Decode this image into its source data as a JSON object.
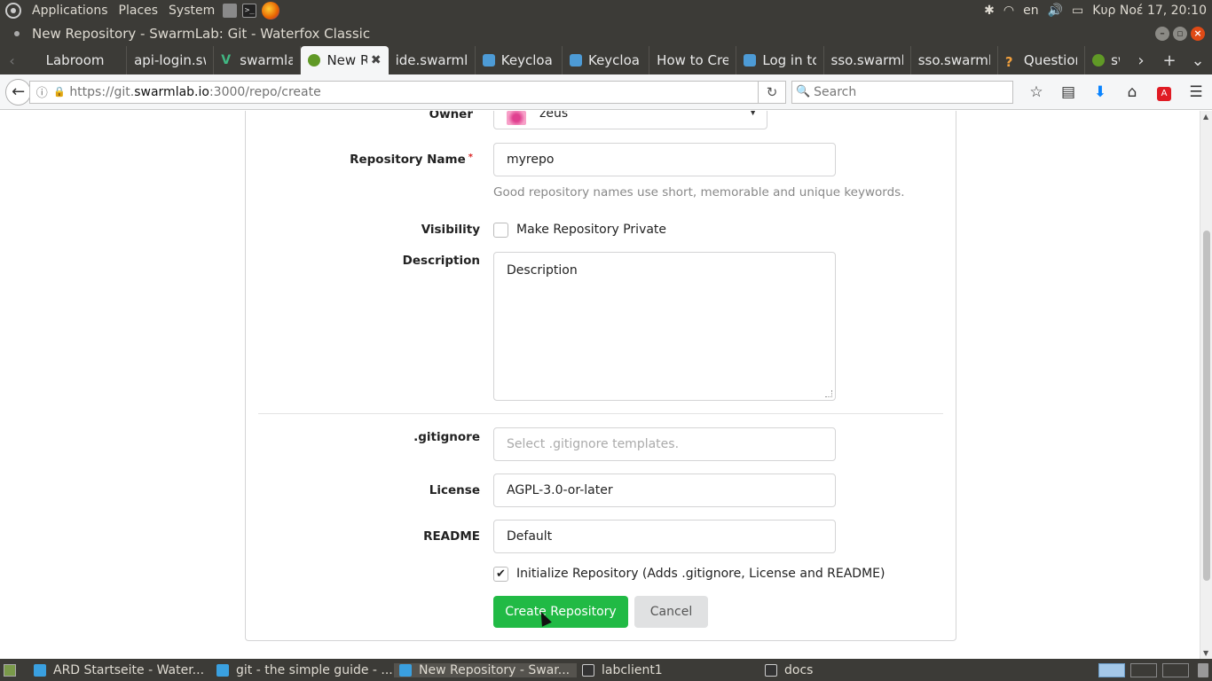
{
  "os_panel": {
    "menus": [
      "Applications",
      "Places",
      "System"
    ],
    "tray": {
      "language": "en",
      "clock": "Κυρ Νοέ 17, 20:10"
    }
  },
  "window": {
    "title": "New Repository - SwarmLab: Git - Waterfox Classic"
  },
  "tabs": [
    {
      "label": "Labroom",
      "icon": "none"
    },
    {
      "label": "api-login.sw",
      "icon": "none"
    },
    {
      "label": "swarmla",
      "icon": "v-icon"
    },
    {
      "label": "New R",
      "icon": "gitea-icon",
      "active": true
    },
    {
      "label": "ide.swarmla",
      "icon": "none"
    },
    {
      "label": "Keycloa",
      "icon": "keycloak-icon"
    },
    {
      "label": "Keycloa",
      "icon": "keycloak-icon"
    },
    {
      "label": "How to Cre",
      "icon": "none"
    },
    {
      "label": "Log in to",
      "icon": "keycloak-icon"
    },
    {
      "label": "sso.swarml",
      "icon": "none"
    },
    {
      "label": "sso.swarml",
      "icon": "none"
    },
    {
      "label": "Question",
      "icon": "question-icon"
    },
    {
      "label": "sw",
      "icon": "gitea-icon"
    }
  ],
  "navbar": {
    "url_prefix": "https://git.",
    "url_domain": "swarmlab.io",
    "url_rest": ":3000/repo/create",
    "search_placeholder": "Search"
  },
  "form": {
    "owner_label": "Owner",
    "owner_value": "zeus",
    "repo_name_label": "Repository Name",
    "repo_name_value": "myrepo",
    "repo_name_hint": "Good repository names use short, memorable and unique keywords.",
    "visibility_label": "Visibility",
    "visibility_option": "Make Repository Private",
    "visibility_checked": false,
    "description_label": "Description",
    "description_placeholder": "Description",
    "gitignore_label": ".gitignore",
    "gitignore_placeholder": "Select .gitignore templates.",
    "license_label": "License",
    "license_value": "AGPL-3.0-or-later",
    "readme_label": "README",
    "readme_value": "Default",
    "init_label": "Initialize Repository (Adds .gitignore, License and README)",
    "init_checked": true,
    "create_button": "Create Repository",
    "cancel_button": "Cancel"
  },
  "colors": {
    "primary_button": "#21ba45",
    "panel": "#3c3b37",
    "required": "#db2828"
  },
  "taskbar": {
    "items": [
      {
        "label": "ARD Startseite - Water...",
        "icon": "waterfox-icon"
      },
      {
        "label": "git - the simple guide - ...",
        "icon": "waterfox-icon"
      },
      {
        "label": "New Repository - Swar...",
        "icon": "waterfox-icon",
        "active": true
      },
      {
        "label": "labclient1",
        "icon": "terminal-icon"
      },
      {
        "label": "docs",
        "icon": "terminal-icon"
      }
    ]
  }
}
